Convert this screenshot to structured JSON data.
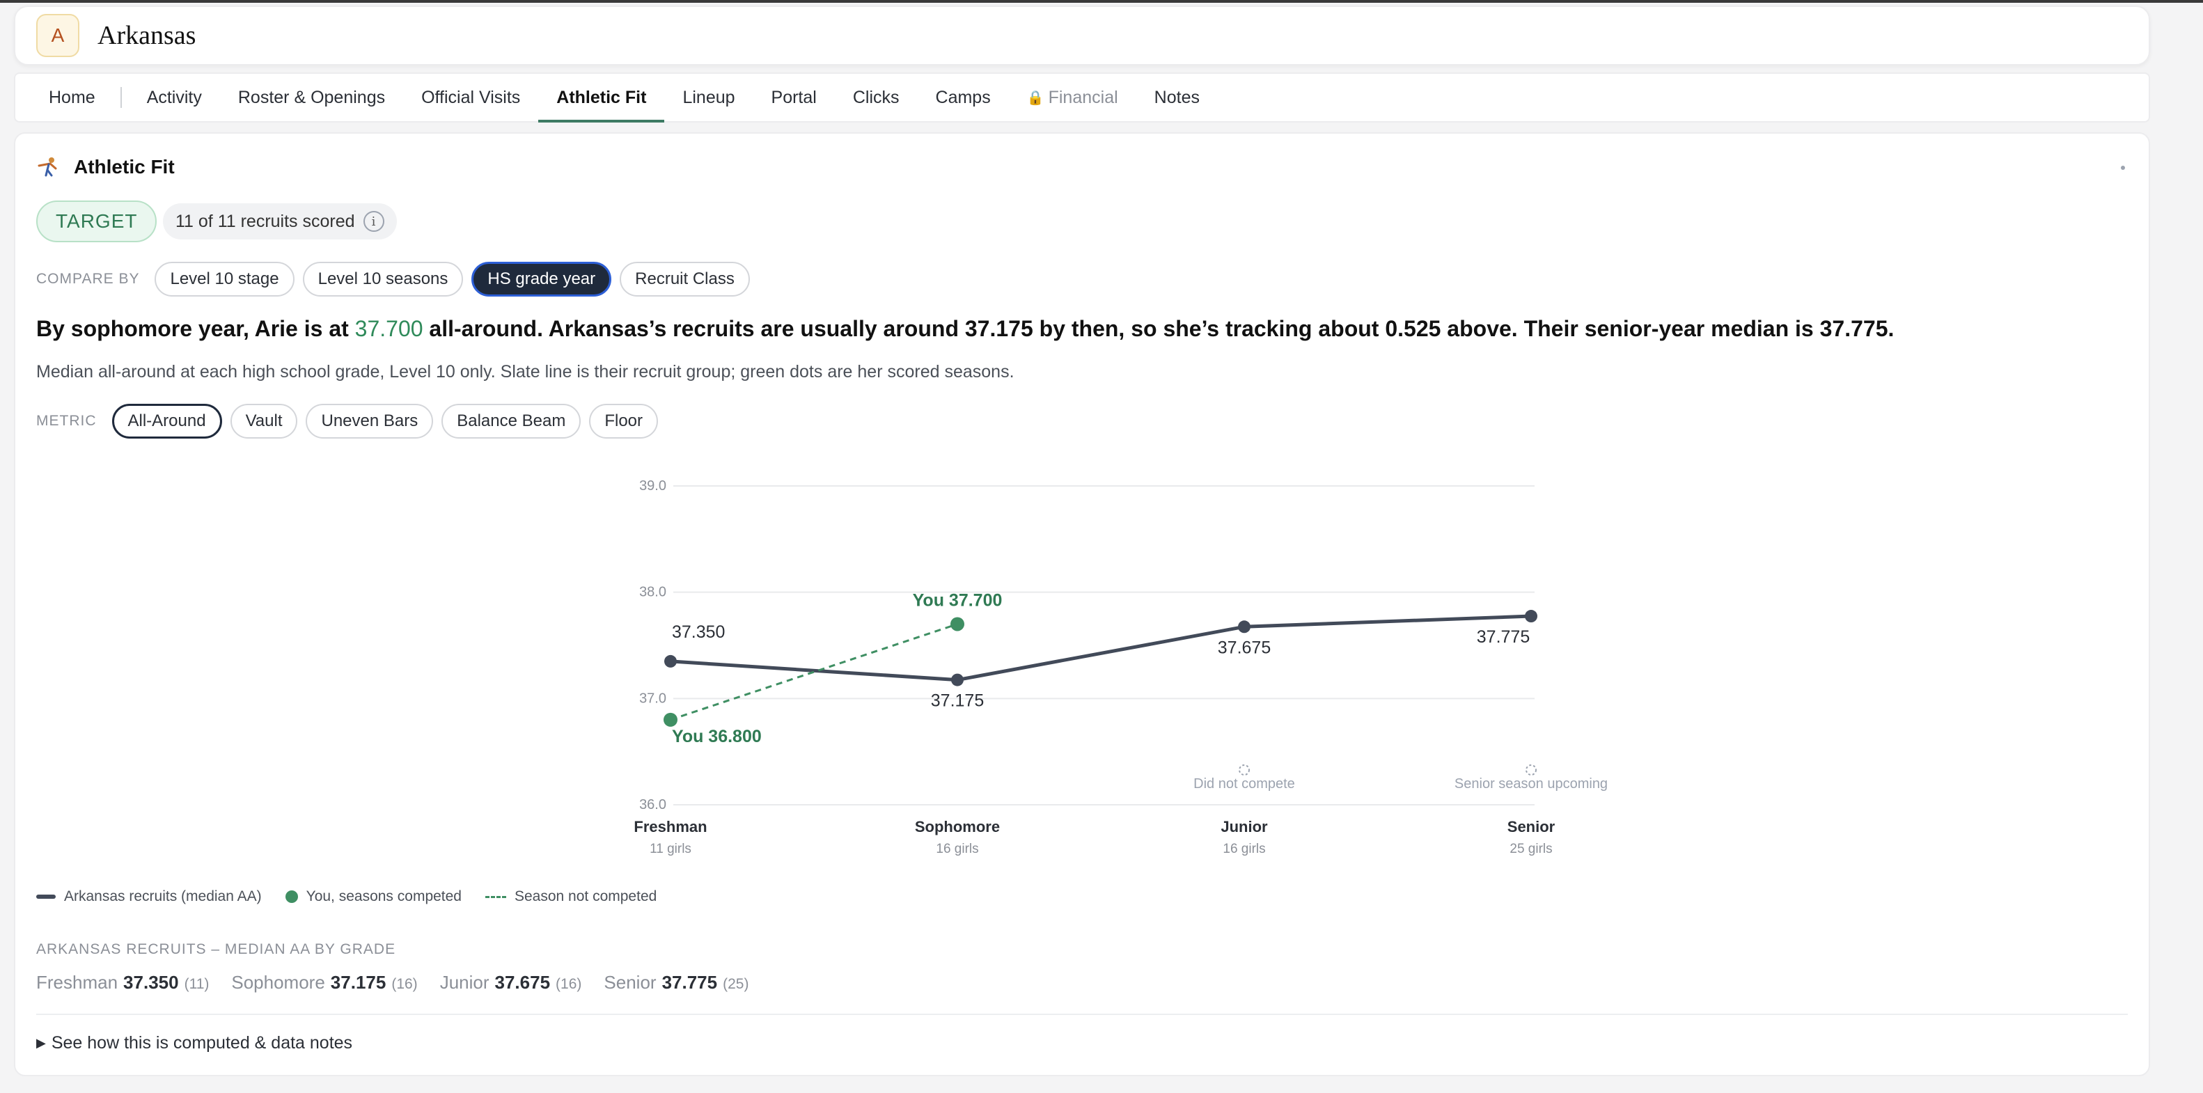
{
  "school": {
    "initial": "A",
    "name": "Arkansas"
  },
  "tabs": [
    {
      "label": "Home"
    },
    {
      "label": "Activity"
    },
    {
      "label": "Roster & Openings"
    },
    {
      "label": "Official Visits"
    },
    {
      "label": "Athletic Fit",
      "active": true
    },
    {
      "label": "Lineup"
    },
    {
      "label": "Portal"
    },
    {
      "label": "Clicks"
    },
    {
      "label": "Camps"
    },
    {
      "label": "Financial",
      "locked": true,
      "icon": "lock-icon"
    },
    {
      "label": "Notes"
    }
  ],
  "section": {
    "title": "Athletic Fit",
    "icon": "gymnast-icon"
  },
  "status": {
    "badge": "TARGET",
    "scored": "11 of 11 recruits scored",
    "info_icon": "i"
  },
  "compare": {
    "label": "COMPARE BY",
    "options": [
      "Level 10 stage",
      "Level 10 seasons",
      "HS grade year",
      "Recruit Class"
    ],
    "selected": "HS grade year"
  },
  "headline": {
    "before": "By sophomore year, Arie is at ",
    "score": "37.700",
    "after": " all-around. Arkansas’s recruits are usually around 37.175 by then, so she’s tracking about 0.525 above. Their senior-year median is 37.775."
  },
  "subline": "Median all-around at each high school grade, Level 10 only. Slate line is their recruit group; green dots are her scored seasons.",
  "metric": {
    "label": "METRIC",
    "options": [
      "All-Around",
      "Vault",
      "Uneven Bars",
      "Balance Beam",
      "Floor"
    ],
    "selected": "All-Around"
  },
  "chart_data": {
    "type": "line",
    "categories": [
      "Freshman",
      "Sophomore",
      "Junior",
      "Senior"
    ],
    "category_counts": [
      "11 girls",
      "16 girls",
      "16 girls",
      "25 girls"
    ],
    "ylim": [
      36.0,
      39.0
    ],
    "yticks": [
      "36.0",
      "37.0",
      "38.0",
      "39.0"
    ],
    "grid": true,
    "series": [
      {
        "name": "Arkansas recruits (median AA)",
        "color": "#424a59",
        "values": [
          37.35,
          37.175,
          37.675,
          37.775
        ],
        "labels": [
          "37.350",
          "37.175",
          "37.675",
          "37.775"
        ]
      },
      {
        "name": "You, seasons competed",
        "color": "#3f8f63",
        "values": [
          36.8,
          37.7,
          null,
          null
        ],
        "labels": [
          "You 36.800",
          "You 37.700",
          null,
          null
        ]
      }
    ],
    "annotations": [
      {
        "category": "Junior",
        "text": "Did not compete"
      },
      {
        "category": "Senior",
        "text": "Senior season upcoming"
      }
    ]
  },
  "legend": {
    "recruits": "Arkansas recruits (median AA)",
    "you": "You, seasons competed",
    "not_competed": "Season not competed"
  },
  "summary": {
    "title": "ARKANSAS RECRUITS – MEDIAN AA BY GRADE",
    "items": [
      {
        "grade": "Freshman",
        "value": "37.350",
        "n": "(11)"
      },
      {
        "grade": "Sophomore",
        "value": "37.175",
        "n": "(16)"
      },
      {
        "grade": "Junior",
        "value": "37.675",
        "n": "(16)"
      },
      {
        "grade": "Senior",
        "value": "37.775",
        "n": "(25)"
      }
    ]
  },
  "details_link": "See how this is computed & data notes",
  "colors": {
    "accent": "#3d7a63",
    "target_green": "#2f7a53",
    "slate": "#424a59",
    "you_green": "#3f8f63"
  }
}
